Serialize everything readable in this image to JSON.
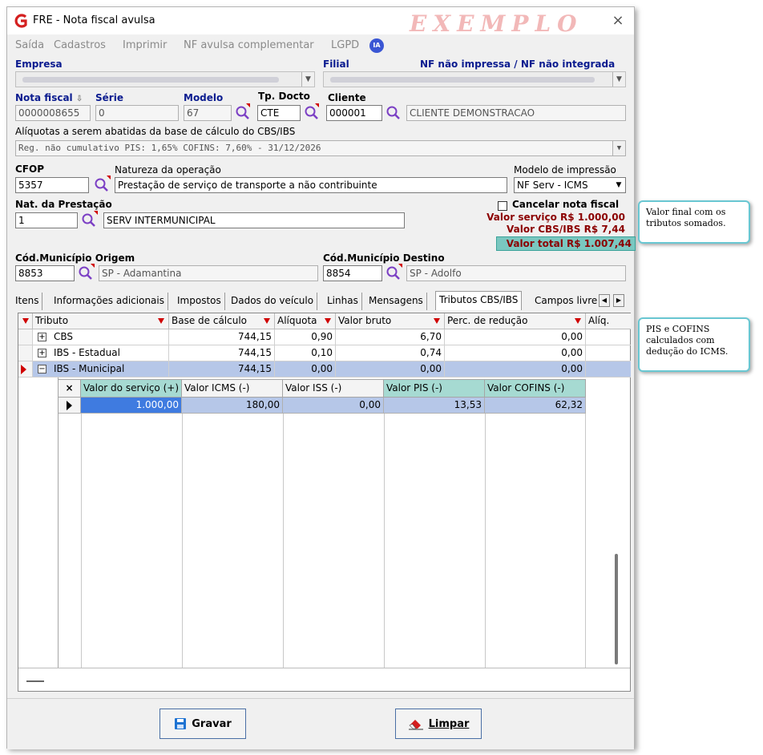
{
  "window": {
    "title": "FRE - Nota fiscal avulsa",
    "watermark": "EXEMPLO",
    "close_glyph": "×"
  },
  "menu": [
    "Saída",
    "Cadastros",
    "Imprimir",
    "NF avulsa complementar",
    "LGPD"
  ],
  "ia_badge": "IA",
  "labels": {
    "empresa": "Empresa",
    "filial": "Filial",
    "nf_status": "NF não impressa / NF não integrada",
    "nota_fiscal": "Nota fiscal",
    "serie": "Série",
    "modelo": "Modelo",
    "tp_docto": "Tp. Docto",
    "cliente": "Cliente",
    "aliquotas": "Alíquotas a serem abatidas da base de cálculo do CBS/IBS",
    "cfop": "CFOP",
    "natureza": "Natureza da operação",
    "modelo_impressao": "Modelo de impressão",
    "nat_prestacao": "Nat. da Prestação",
    "cancelar": "Cancelar nota fiscal",
    "mun_origem": "Cód.Município Origem",
    "mun_destino": "Cód.Município Destino"
  },
  "fields": {
    "nota_fiscal": "0000008655",
    "serie": "0",
    "modelo": "67",
    "tp_docto": "CTE",
    "cliente_cod": "000001",
    "cliente_nome": "CLIENTE DEMONSTRACAO",
    "aliquotas": "Reg. não cumulativo PIS: 1,65% COFINS: 7,60% - 31/12/2026",
    "cfop": "5357",
    "natureza": "Prestação de serviço de transporte a não contribuinte",
    "modelo_impressao": "NF Serv - ICMS",
    "nat_prestacao": "1",
    "nat_prestacao_desc": "SERV INTERMUNICIPAL",
    "mun_origem": "8853",
    "mun_origem_desc": "SP - Adamantina",
    "mun_destino": "8854",
    "mun_destino_desc": "SP - Adolfo"
  },
  "totals": {
    "valor_servico": "Valor serviço R$ 1.000,00",
    "valor_cbs_ibs": "Valor CBS/IBS R$ 7,44",
    "valor_total": "Valor total R$ 1.007,44"
  },
  "tabs": [
    "Itens",
    "Informações adicionais",
    "Impostos",
    "Dados do veículo",
    "Linhas",
    "Mensagens",
    "Tributos CBS/IBS",
    "Campos livre"
  ],
  "grid": {
    "headers": [
      "Tributo",
      "Base de cálculo",
      "Alíquota",
      "Valor bruto",
      "Perc. de redução",
      "Alíq."
    ],
    "rows": [
      {
        "expander": "+",
        "tributo": "CBS",
        "base": "744,15",
        "aliquota": "0,90",
        "valor_bruto": "6,70",
        "perc_reducao": "0,00"
      },
      {
        "expander": "+",
        "tributo": "IBS - Estadual",
        "base": "744,15",
        "aliquota": "0,10",
        "valor_bruto": "0,74",
        "perc_reducao": "0,00"
      },
      {
        "expander": "−",
        "tributo": "IBS - Municipal",
        "base": "744,15",
        "aliquota": "0,00",
        "valor_bruto": "0,00",
        "perc_reducao": "0,00"
      }
    ]
  },
  "subgrid": {
    "close_glyph": "×",
    "headers": [
      "Valor do serviço (+)",
      "Valor ICMS (-)",
      "Valor ISS (-)",
      "Valor PIS (-)",
      "Valor COFINS (-)"
    ],
    "row": [
      "1.000,00",
      "180,00",
      "0,00",
      "13,53",
      "62,32"
    ]
  },
  "buttons": {
    "gravar": "Gravar",
    "limpar": "Limpar"
  },
  "callouts": {
    "total": "Valor final com os tributos somados.",
    "pis": "PIS e COFINS calculados com dedução do ICMS."
  },
  "colors": {
    "label_blue": "#0a1b8f",
    "value_red": "#8b0000",
    "teal_highlight": "#7ac7c0",
    "selected_row": "#b6c7e8",
    "callout_border": "#69c7d2"
  }
}
